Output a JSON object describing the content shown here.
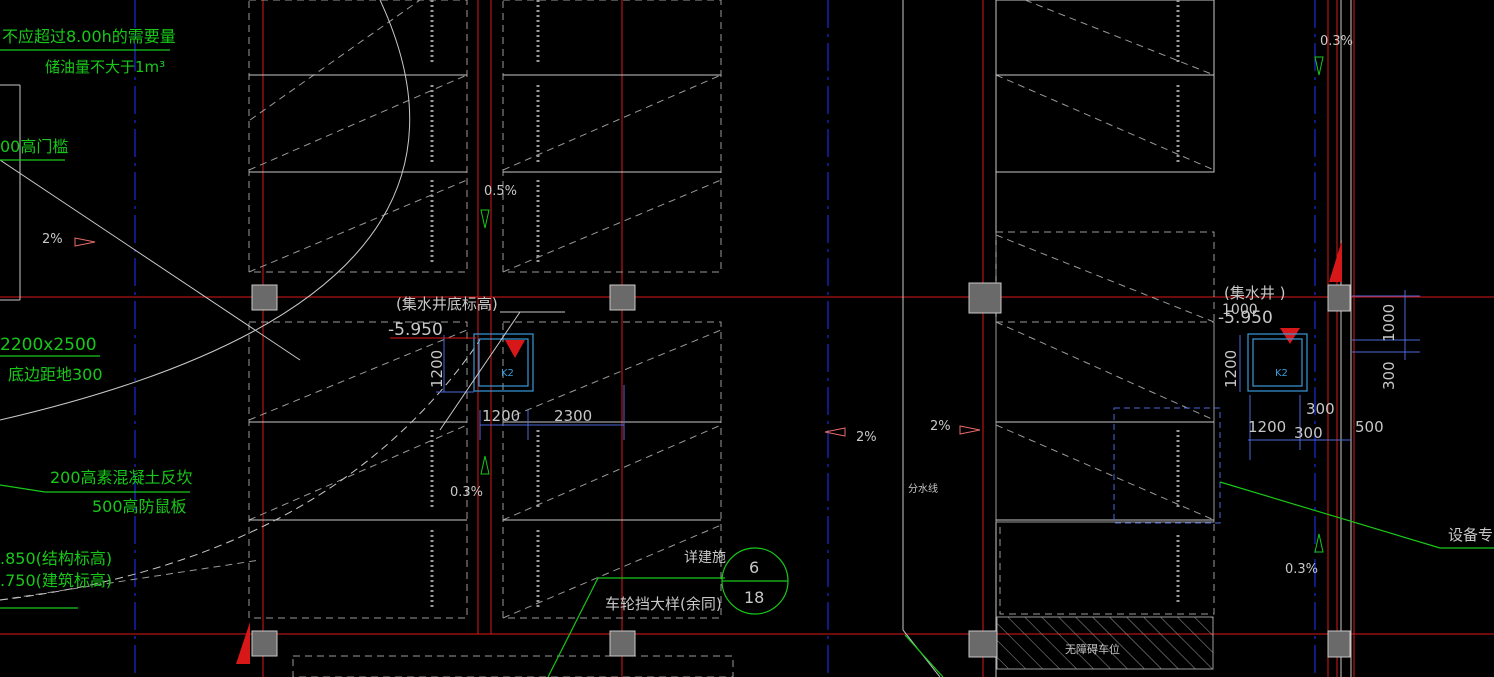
{
  "colors": {
    "background": "#000000",
    "grid_red": "#d81818",
    "axis_blue": "#1c2ad8",
    "outline_white": "#c8c8c8",
    "dash_white": "#9a9a9a",
    "annotation_green": "#18c818",
    "dimension_blue": "#4a6ad8",
    "pit_cyan": "#3a9ad8",
    "column_gray": "#9a9a9a"
  },
  "annotations": {
    "oil_usage": "不应超过8.00h的需要量",
    "oil_storage": "储油量不大于1m³",
    "sill": "00高门槛",
    "size": "2200x2500",
    "bottom_distance": "底边距地300",
    "concrete_curb": "200高素混凝土反坎",
    "rat_board": "500高防鼠板",
    "struct_elev": ".850(结构标高)",
    "arch_elev": ".750(建筑标高)",
    "detail_ref": "详建施",
    "wheel_stop": "车轮挡大样(余同)",
    "detail_num": "6",
    "sheet_num": "18",
    "equipment": "设备专",
    "divide_line": "分水线",
    "barrier_free": "无障碍车位"
  },
  "sump_left": {
    "title": "(集水井底标高)",
    "elev": "-5.950",
    "tag": "K2",
    "dim_vertical": "1200",
    "dim_h1": "1200",
    "dim_h2": "2300"
  },
  "sump_right": {
    "title": "(集水井 )",
    "elev": "-5.950",
    "overlap": "1000",
    "tag": "K2",
    "dim_vertical": "1200",
    "dim_h1": "1200",
    "dim_300a": "300",
    "dim_300b": "300",
    "dim_500": "500",
    "dim_1000": "1000",
    "dim_300v": "300"
  },
  "slopes": {
    "s1": "2%",
    "s2": "0.5%",
    "s3": "0.3%",
    "s4": "2%",
    "s5": "2%",
    "s6": "0.3%",
    "s7": "0.3%"
  }
}
